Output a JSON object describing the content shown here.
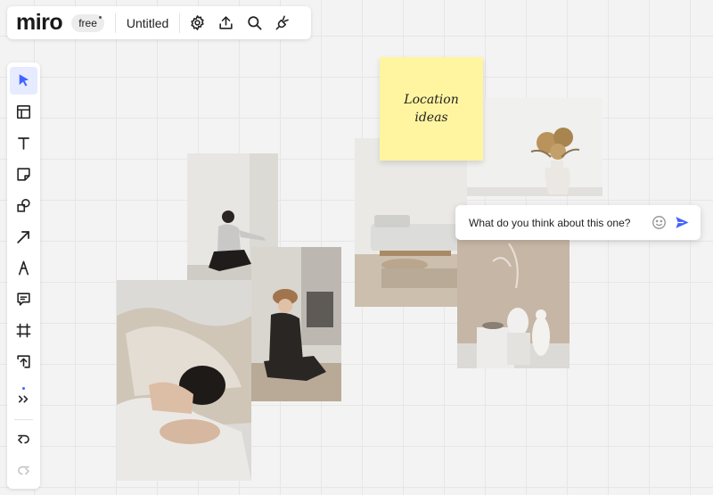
{
  "topbar": {
    "logo": "miro",
    "plan_badge": "free",
    "board_title": "Untitled",
    "icons": [
      "settings-icon",
      "upload-icon",
      "search-icon",
      "plugin-icon"
    ]
  },
  "toolbar": {
    "tools": [
      "select",
      "templates",
      "text",
      "sticky-note",
      "shapes",
      "connection-line",
      "pen",
      "comment",
      "frame",
      "upload",
      "more"
    ],
    "active_tool": "select",
    "history": [
      "undo",
      "redo"
    ]
  },
  "board": {
    "sticky_note": {
      "text": "Location ideas",
      "color": "#fff5a0"
    },
    "comment": {
      "placeholder": "What do you think about this one?"
    },
    "photos": [
      "woman-sitting-photo",
      "woman-curled-photo",
      "woman-hat-photo",
      "living-room-photo",
      "dried-flowers-vase-photo",
      "sculptures-photo"
    ]
  },
  "colors": {
    "accent": "#4262ff",
    "canvas": "#f3f3f3",
    "grid": "#e6e6e6",
    "sticky": "#fff5a0"
  }
}
